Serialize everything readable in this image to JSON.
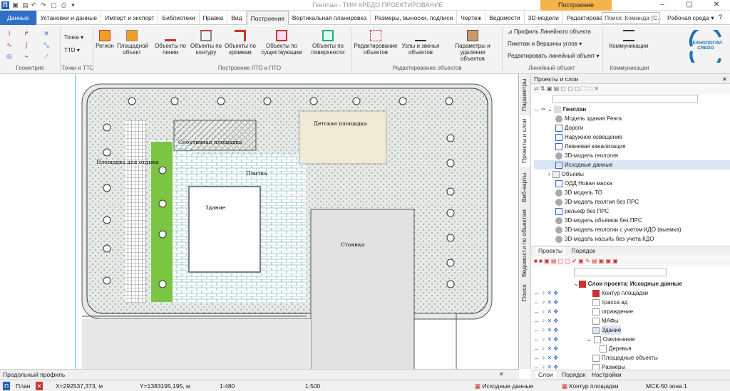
{
  "window": {
    "title": "Генплан - ТИМ КРЕДО ПРОЕКТИРОВАНИЕ",
    "context_tab": "Построение"
  },
  "tabs": [
    "Данные",
    "Установки и данные",
    "Импорт и экспорт",
    "Библиотеки",
    "Правка",
    "Вид",
    "Построения",
    "Вертикальная планировка",
    "Размеры, выноски, подписи",
    "Чертеж",
    "Ведомости",
    "3D-модели",
    "Редактирование"
  ],
  "search": {
    "value": "Поиск: Команда (С..."
  },
  "workspace": {
    "label": "Рабочая среда"
  },
  "ribbon": {
    "tochka": "Точка",
    "tto": "ТТО",
    "buttons": [
      "Регион",
      "Площадной объект",
      "Объекты по линии",
      "Объекты по контуру",
      "Объекты по кромкам",
      "Объекты по существующим",
      "Объекты по поверхности",
      "Редактирование объектов",
      "Узлы и звенья объектов",
      "Параметры и удаление объектов"
    ],
    "linear": [
      "Профиль Линейного объекта",
      "Пикетаж и Вершины углов",
      "Редактировать линейный объект"
    ],
    "communications": "Коммуникации",
    "groups": [
      "Геометрия",
      "Точки и ТТО",
      "Построение ЛТО и ПТО",
      "Редактирование объектов",
      "Линейный объект",
      "Коммуникации"
    ],
    "brand": "ТЕХНОЛОГИИ CREDO"
  },
  "map": {
    "labels": {
      "sport": "Спортивная площадка",
      "kids": "Детская площадка",
      "rest": "Площадка для отдыха",
      "tile": "Плитка",
      "building": "Здание",
      "parking": "Стоянка"
    }
  },
  "side_tabs": [
    "Параметры",
    "Проекты и слои",
    "Веб-карты",
    "Ведомости по объектам",
    "Поиск"
  ],
  "projects_panel": {
    "title": "Проекты и слои",
    "root": "Генплан",
    "items": [
      "Модель здания Ренга",
      "Дороги",
      "Наружное освещение",
      "Ливневая канализация",
      "3D-модель геология",
      "Исходные данные",
      "Объемы",
      "ОДД Новая маска",
      "3D модель ТО",
      "3D-модель геолгия без ПРС",
      "рельеф без ПРС",
      "3D-модель объёмов без ПРС",
      "3D-модель геологии с учетом КДО (выемка)",
      "3D-модель насыпь без учета КДО"
    ],
    "tabs": [
      "Проекты",
      "Порядок"
    ]
  },
  "layers_panel": {
    "title": "Слои проекта: Исходные данные",
    "items": [
      "Контур площадки",
      "трасса ад",
      "ограждение",
      "МАФы",
      "Здание",
      "Озеленение",
      "Деревья",
      "Площадные объекты",
      "Размеры"
    ],
    "tabs": [
      "Слои",
      "Порядок",
      "Настройки"
    ]
  },
  "bottom_panel": {
    "title": "Продольный профиль"
  },
  "status": {
    "plan": "План",
    "x": "X=292537,373, м",
    "y": "Y=1383195,195, м",
    "scale1": "1:480",
    "scale2": "1:500",
    "layer": "Исходные данные",
    "object": "Контур площадки",
    "crs": "МСК-50 зона 1"
  }
}
